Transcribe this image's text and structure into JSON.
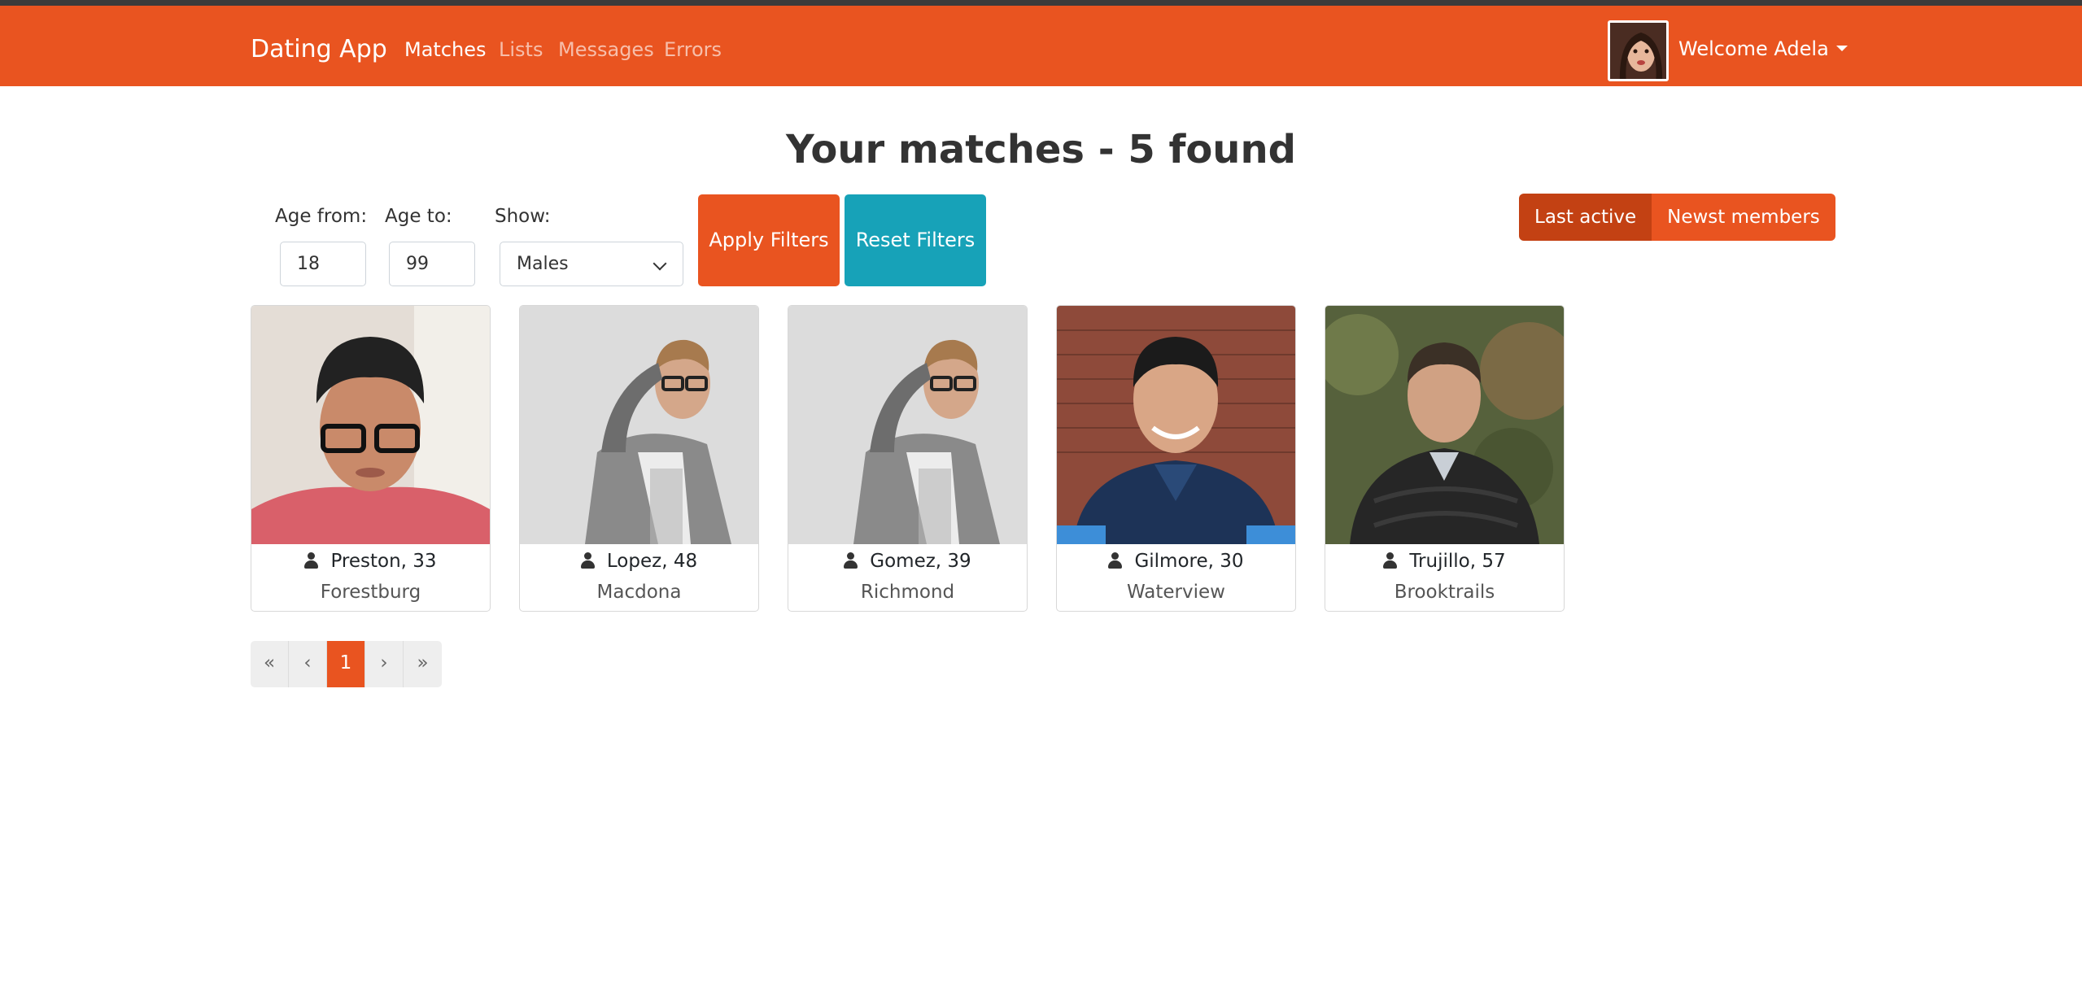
{
  "nav": {
    "brand": "Dating App",
    "links": [
      "Matches",
      "Lists",
      "Messages",
      "Errors"
    ],
    "welcome": "Welcome Adela"
  },
  "page": {
    "title": "Your matches - 5 found"
  },
  "filters": {
    "age_from_label": "Age from:",
    "age_from_value": "18",
    "age_to_label": "Age to:",
    "age_to_value": "99",
    "show_label": "Show:",
    "show_value": "Males",
    "apply_label": "Apply Filters",
    "reset_label": "Reset Filters"
  },
  "sort": {
    "last_active": "Last active",
    "newest": "Newst members"
  },
  "members": [
    {
      "name": "Preston, 33",
      "city": "Forestburg"
    },
    {
      "name": "Lopez, 48",
      "city": "Macdona"
    },
    {
      "name": "Gomez, 39",
      "city": "Richmond"
    },
    {
      "name": "Gilmore, 30",
      "city": "Waterview"
    },
    {
      "name": "Trujillo, 57",
      "city": "Brooktrails"
    }
  ],
  "pagination": {
    "first": "«",
    "prev": "‹",
    "current": "1",
    "next": "›",
    "last": "»"
  },
  "colors": {
    "primary": "#e95420",
    "primary_active": "#c34113",
    "info": "#17a2b8"
  }
}
